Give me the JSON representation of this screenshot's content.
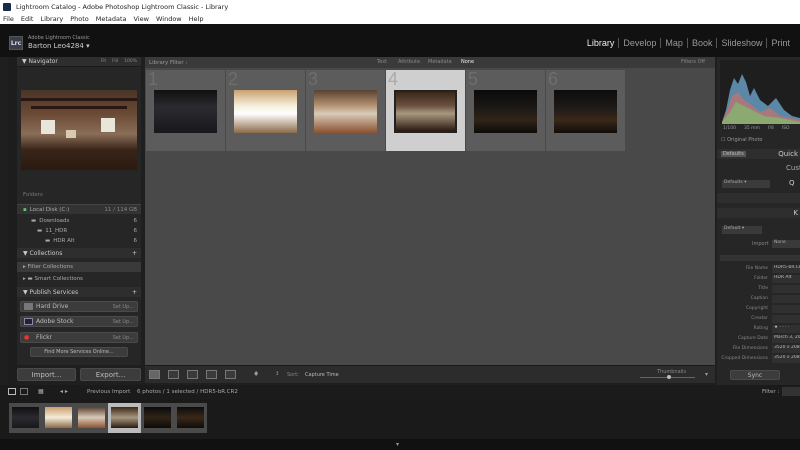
{
  "window": {
    "title": "Lightroom Catalog - Adobe Photoshop Lightroom Classic - Library"
  },
  "menu": [
    "File",
    "Edit",
    "Library",
    "Photo",
    "Metadata",
    "View",
    "Window",
    "Help"
  ],
  "identity": {
    "logo": "Lrc",
    "app": "Adobe Lightroom Classic",
    "user": "Barton Leo4284"
  },
  "modules": [
    "Library",
    "Develop",
    "Map",
    "Book",
    "Slideshow",
    "Print"
  ],
  "left": {
    "navigator": {
      "title": "Navigator",
      "zoom": [
        "Fit",
        "Fill",
        "100%"
      ]
    },
    "folders": {
      "volume": "Local Disk (C:)",
      "volume_size": "11 / 114 GB",
      "items": [
        {
          "label": "Downloads",
          "count": "6"
        },
        {
          "label": "11_HDR",
          "count": "6"
        },
        {
          "label": "HDR Alt",
          "count": "6"
        }
      ],
      "partial": "Folders"
    },
    "collections": {
      "title": "Collections",
      "items": [
        "Filter Collections",
        "Smart Collections"
      ]
    },
    "publish": {
      "title": "Publish Services",
      "items": [
        {
          "label": "Hard Drive",
          "action": "Set Up..."
        },
        {
          "label": "Adobe Stock",
          "action": "Set Up..."
        },
        {
          "label": "Flickr",
          "action": "Set Up..."
        }
      ],
      "find_more": "Find More Services Online..."
    },
    "import_label": "Import...",
    "export_label": "Export..."
  },
  "filterbar": {
    "title": "Library Filter :",
    "options": [
      "Text",
      "Attribute",
      "Metadata",
      "None"
    ],
    "active": "None",
    "filters_off": "Filters Off"
  },
  "grid": {
    "numbers": [
      "1",
      "2",
      "3",
      "4",
      "5",
      "6"
    ],
    "selected_index": 3
  },
  "toolbar": {
    "sort_label": "Sort:",
    "sort_value": "Capture Time",
    "thumbnails": "Thumbnails"
  },
  "right": {
    "histogram": {
      "readout": [
        "1/100",
        "35 mm",
        "f/8",
        "ISO"
      ],
      "original_photo": "Original Photo"
    },
    "quick_develop": {
      "saved_preset": "Defaults",
      "label": "Quick",
      "custom": "Custom",
      "q": "Q"
    },
    "keywording": "K",
    "metadata": {
      "preset": "Default",
      "import": "Import",
      "preset_value": "None",
      "fields": [
        {
          "label": "File Name",
          "value": "HDR5-bR.CR2"
        },
        {
          "label": "Folder",
          "value": "HDR Alt"
        },
        {
          "label": "Title",
          "value": ""
        },
        {
          "label": "Caption",
          "value": ""
        },
        {
          "label": "Copyright",
          "value": ""
        },
        {
          "label": "Creator",
          "value": ""
        },
        {
          "label": "Rating",
          "value": "★ · · · ·"
        },
        {
          "label": "Capture Date",
          "value": "March 3, 20"
        },
        {
          "label": "File Dimensions",
          "value": "3520 x 2080"
        },
        {
          "label": "Cropped Dimensions",
          "value": "3520 x 2080"
        }
      ]
    },
    "sync": "Sync"
  },
  "filmstrip": {
    "prev": "Previous Import",
    "info": "6 photos / 1 selected / HDR5-bR.CR2",
    "filter": "Filter :"
  },
  "colors": {
    "accent": "#ffffff",
    "panel": "#262626",
    "grid": "#494949",
    "selected": "#cfcfcf"
  }
}
